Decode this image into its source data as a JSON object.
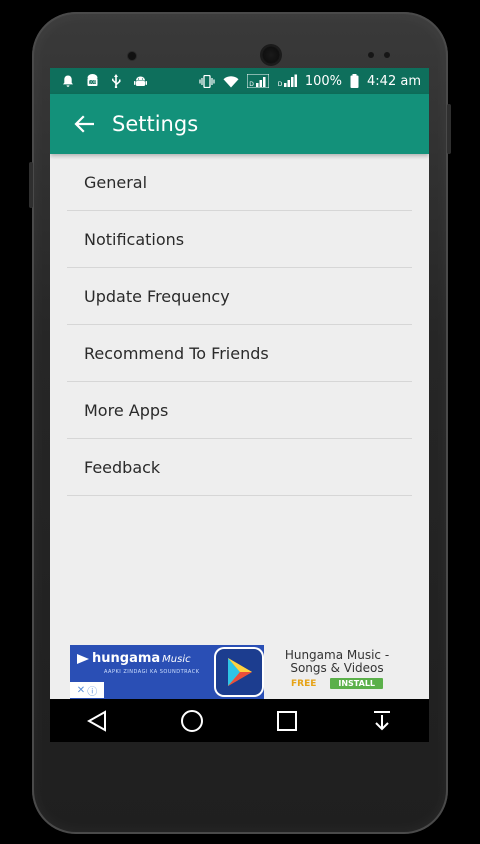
{
  "status_bar": {
    "battery": "100%",
    "time": "4:42 am",
    "left_icons": [
      "bell-icon",
      "android-icon",
      "usb-icon",
      "android-icon"
    ],
    "right_icons": [
      "vibrate-icon",
      "wifi-icon",
      "signal-icon",
      "signal-icon",
      "battery-icon"
    ]
  },
  "app_bar": {
    "title": "Settings",
    "back_icon": "arrow-left-icon"
  },
  "settings": {
    "items": [
      {
        "label": "General"
      },
      {
        "label": "Notifications"
      },
      {
        "label": "Update Frequency"
      },
      {
        "label": "Recommend To Friends"
      },
      {
        "label": "More Apps"
      },
      {
        "label": "Feedback"
      }
    ]
  },
  "ad": {
    "brand": "hungama",
    "brand_script": "Music",
    "tagline": "AAPKI ZINDAGI KA SOUNDTRACK",
    "title_line1": "Hungama Music -",
    "title_line2": "Songs & Videos",
    "price": "FREE",
    "install_label": "INSTALL"
  },
  "nav_bar": {
    "buttons": [
      "back-triangle-icon",
      "home-circle-icon",
      "recents-square-icon",
      "download-icon"
    ]
  },
  "colors": {
    "status_bar": "#0e6f5c",
    "app_bar": "#13917a",
    "background": "#eeeeee",
    "ad_blue": "#2a4fb5",
    "install_green": "#5bb04a"
  }
}
